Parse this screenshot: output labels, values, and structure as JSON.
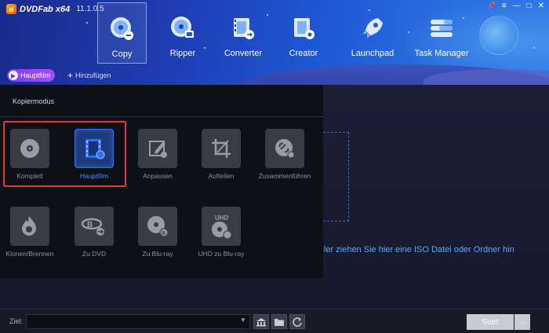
{
  "app": {
    "logo_mark": "d",
    "name": "DVDFab x64",
    "version": "11.1.0.5"
  },
  "window_controls": {
    "pin": "📌",
    "menu": "≡",
    "minimize": "—",
    "maximize": "□",
    "close": "✕"
  },
  "nav": {
    "items": [
      {
        "label": "Copy",
        "icon": "copy-disc-icon"
      },
      {
        "label": "Ripper",
        "icon": "ripper-disc-icon"
      },
      {
        "label": "Converter",
        "icon": "converter-film-icon"
      },
      {
        "label": "Creator",
        "icon": "creator-film-icon"
      },
      {
        "label": "Launchpad",
        "icon": "rocket-icon"
      },
      {
        "label": "Task Manager",
        "icon": "task-list-icon"
      }
    ],
    "active": "Copy"
  },
  "subbar": {
    "mode_pill": "Hauptfilm",
    "add_label": "Hinzufügen"
  },
  "panel": {
    "title": "Kopiermodus",
    "modes": [
      {
        "label": "Komplett",
        "icon": "disc-icon",
        "active": false
      },
      {
        "label": "Hauptfilm",
        "icon": "film-icon",
        "active": true
      },
      {
        "label": "Anpassen",
        "icon": "edit-icon",
        "active": false
      },
      {
        "label": "Aufteilen",
        "icon": "crop-icon",
        "active": false
      },
      {
        "label": "Zusammenführen",
        "icon": "link-icon",
        "active": false
      },
      {
        "label": "Klonen/Brennen",
        "icon": "flame-icon",
        "active": false
      },
      {
        "label": "Zu DVD",
        "icon": "bluray-to-dvd-icon",
        "active": false
      },
      {
        "label": "Zu Blu-ray",
        "icon": "bluray-disc-icon",
        "active": false
      },
      {
        "label": "UHD zu Blu-ray",
        "icon": "uhd-disc-icon",
        "active": false
      }
    ]
  },
  "main": {
    "drop_hint": "ler ziehen Sie hier eine ISO Datei oder Ordner hin"
  },
  "bottom": {
    "ziel_label": "Ziel:",
    "ziel_value": "",
    "start_label": "Start"
  },
  "colors": {
    "accent": "#2f6fff",
    "highlight_box": "#e23a3a",
    "pill": "#8a44ff",
    "drop_text": "#5aa9ff"
  }
}
